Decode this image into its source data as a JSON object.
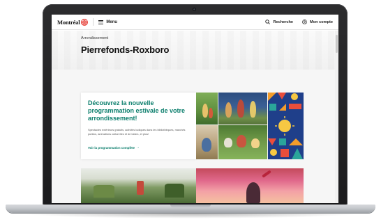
{
  "header": {
    "logo_text": "Montréal",
    "menu_label": "Menu",
    "search_label": "Recherche",
    "account_label": "Mon compte",
    "logo_color": "#e2231a"
  },
  "hero": {
    "label": "Arrondissement",
    "title": "Pierrefonds-Roxboro"
  },
  "promo": {
    "title": "Découvrez la nouvelle programmation estivale de votre arrondissement!",
    "text": "Spectacles extérieurs gratuits, activités ludiques dans les bibliothèques, marchés publics, animations culturelles et de loisirs, et plus!",
    "link_label": "Voir la programmation complète",
    "accent_color": "#097d6b"
  },
  "icons": {
    "menu": "hamburger-icon",
    "search": "search-icon",
    "account": "user-icon",
    "link_arrow": "arrow-right-icon"
  }
}
